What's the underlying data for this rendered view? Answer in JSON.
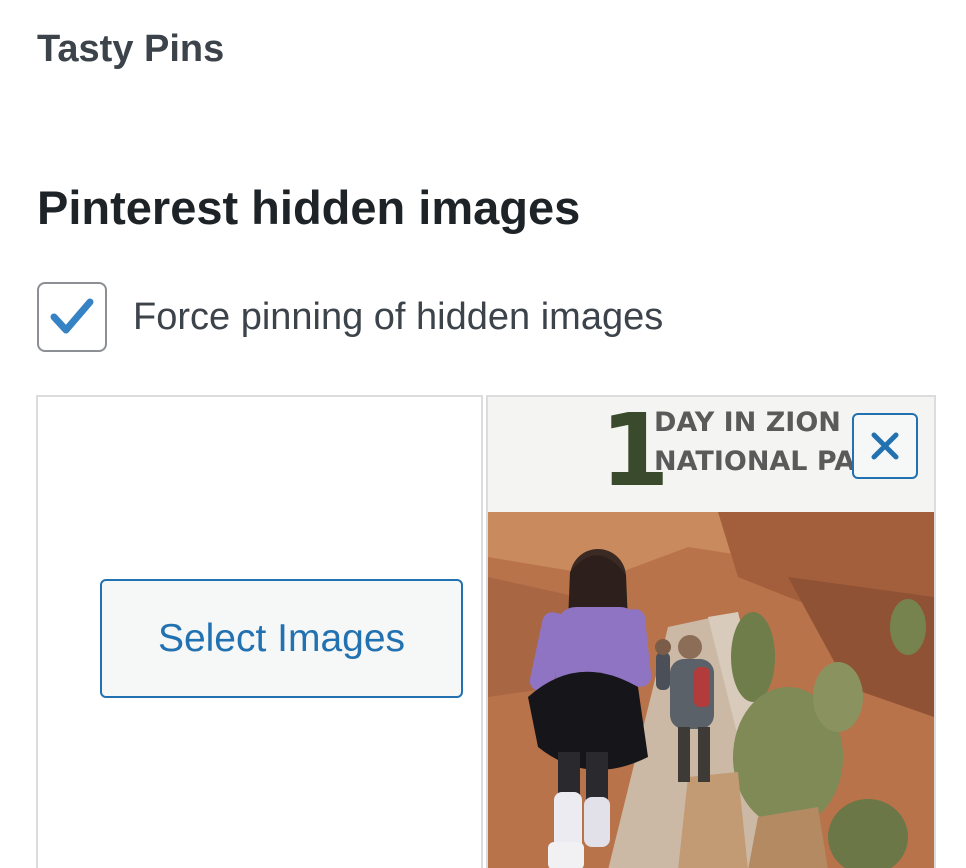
{
  "panel": {
    "title": "Tasty Pins"
  },
  "section": {
    "title": "Pinterest hidden images"
  },
  "force_pinning": {
    "label": "Force pinning of hidden images",
    "checked": true
  },
  "gallery": {
    "select_button_label": "Select Images",
    "images": [
      {
        "overlay_number": "1",
        "overlay_text_line1": "DAY IN ZION",
        "overlay_text_line2": "NATIONAL PA"
      }
    ]
  },
  "icons": {
    "checkbox": "checkmark-icon",
    "remove": "close-icon"
  },
  "colors": {
    "accent": "#2271b1",
    "checkmark": "#3582c4",
    "border": "#dcdcde",
    "text_dark": "#1d2327",
    "text_muted": "#3c434a"
  }
}
